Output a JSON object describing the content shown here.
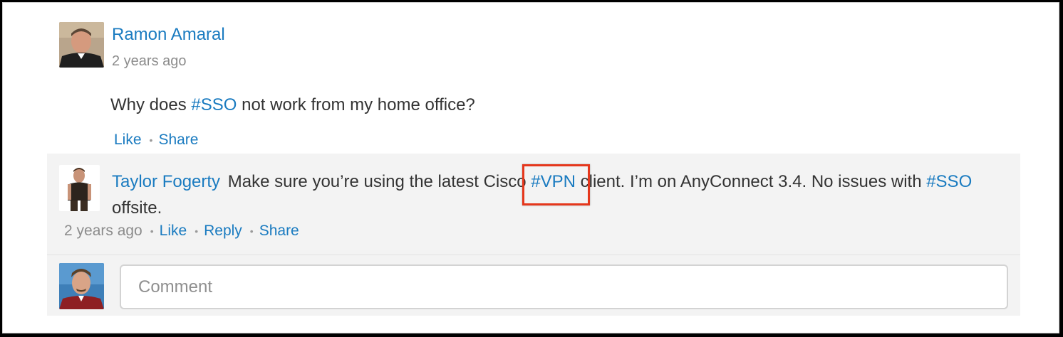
{
  "post": {
    "author": "Ramon Amaral",
    "time": "2 years ago",
    "body_prefix": "Why does ",
    "body_hashtag": "#SSO",
    "body_suffix": " not work from my home office?",
    "like_label": "Like",
    "share_label": "Share"
  },
  "comment": {
    "author": "Taylor Fogerty",
    "text_part1": "Make sure you’re using the latest Cisco ",
    "hashtag_vpn": "#VPN",
    "text_part2": " client. I’m on AnyConnect 3.4. No issues with ",
    "hashtag_sso": "#SSO",
    "text_part3": " offsite.",
    "time": "2 years ago",
    "like_label": "Like",
    "reply_label": "Reply",
    "share_label": "Share"
  },
  "new_comment": {
    "placeholder": "Comment",
    "value": ""
  },
  "separator": "•",
  "colors": {
    "link": "#1a7bc0",
    "highlight": "#e5371c",
    "comments_bg": "#f3f3f3"
  },
  "icons": {
    "post_avatar": "avatar-ramon-amaral",
    "comment_avatar": "avatar-taylor-fogerty",
    "current_user_avatar": "avatar-current-user"
  }
}
